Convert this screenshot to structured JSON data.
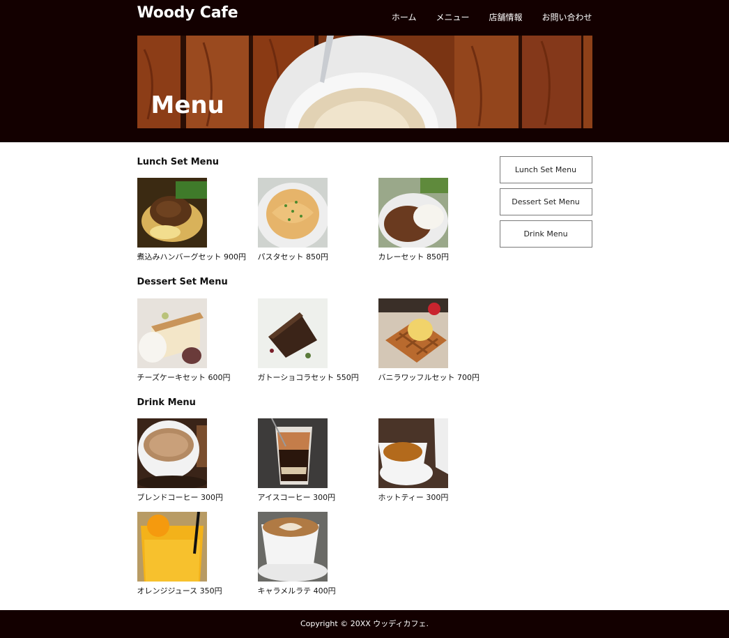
{
  "header": {
    "logo": "Woody Cafe",
    "nav": [
      "ホーム",
      "メニュー",
      "店舗情報",
      "お問い合わせ"
    ],
    "hero_title": "Menu"
  },
  "sections": [
    {
      "title": "Lunch Set Menu",
      "items": [
        {
          "caption": "煮込みハンバーグセット 900円"
        },
        {
          "caption": "パスタセット 850円"
        },
        {
          "caption": "カレーセット 850円"
        }
      ]
    },
    {
      "title": "Dessert Set Menu",
      "items": [
        {
          "caption": "チーズケーキセット 600円"
        },
        {
          "caption": "ガトーショコラセット 550円"
        },
        {
          "caption": "バニラワッフルセット 700円"
        }
      ]
    },
    {
      "title": "Drink Menu",
      "items": [
        {
          "caption": "ブレンドコーヒー 300円"
        },
        {
          "caption": "アイスコーヒー 300円"
        },
        {
          "caption": "ホットティー 300円"
        },
        {
          "caption": "オレンジジュース 350円"
        },
        {
          "caption": "キャラメルラテ 400円"
        }
      ]
    }
  ],
  "sidebar": [
    "Lunch Set Menu",
    "Dessert Set Menu",
    "Drink Menu"
  ],
  "footer": "Copyright © 20XX ウッディカフェ.",
  "colors": {
    "header_bg": "#130000",
    "footer_bg": "#130000",
    "sidebar_border": "#7a7a7a"
  }
}
